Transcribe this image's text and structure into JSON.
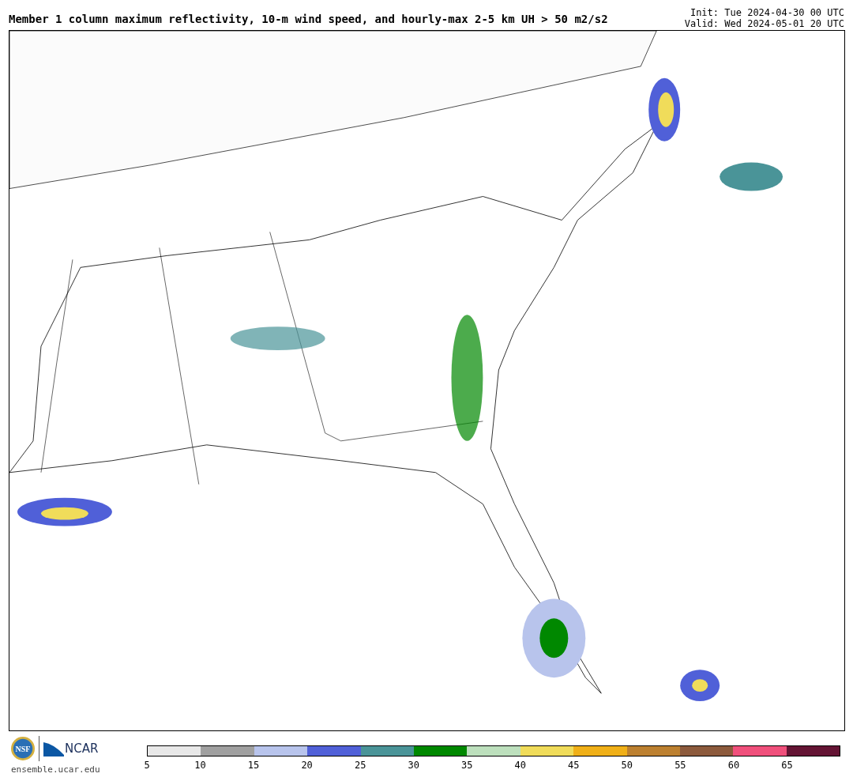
{
  "title": "Member 1 column maximum reflectivity, 10-m wind speed, and hourly-max 2-5 km UH > 50 m2/s2",
  "init": "Init: Tue 2024-04-30 00 UTC",
  "valid": "Valid: Wed 2024-05-01 20 UTC",
  "logos": {
    "seal": "NSF",
    "wordmark": "NCAR"
  },
  "url": "ensemble.ucar.edu",
  "colorbar": {
    "bins": [
      {
        "color": "#e8e8e8"
      },
      {
        "color": "#a0a0a0"
      },
      {
        "color": "#b8c4ec"
      },
      {
        "color": "#5060d8"
      },
      {
        "color": "#4a9498"
      },
      {
        "color": "#008800"
      },
      {
        "color": "#bde0bd"
      },
      {
        "color": "#f0dc5a"
      },
      {
        "color": "#f0b018"
      },
      {
        "color": "#bc8030"
      },
      {
        "color": "#8c5a3c"
      },
      {
        "color": "#f0507c"
      },
      {
        "color": "#641434"
      }
    ],
    "ticks": [
      "5",
      "10",
      "15",
      "20",
      "25",
      "30",
      "35",
      "40",
      "45",
      "50",
      "55",
      "60",
      "65"
    ]
  }
}
